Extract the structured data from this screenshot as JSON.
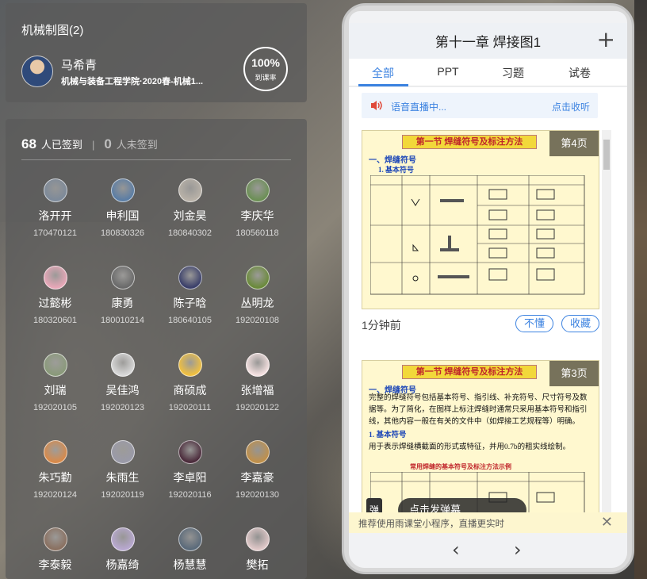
{
  "course": {
    "title": "机械制图(2)",
    "teacher_name": "马希青",
    "school": "机械与装备工程学院·2020春-机械1...",
    "attendance_rate": "100%",
    "attendance_rate_label": "到课率"
  },
  "attendance": {
    "signed_count": "68",
    "signed_label": "人已签到",
    "separator": "|",
    "unsigned_count": "0",
    "unsigned_label": "人未签到",
    "students": [
      {
        "name": "洛开开",
        "id": "170470121",
        "color": "#7d8a9a"
      },
      {
        "name": "申利国",
        "id": "180830326",
        "color": "#5a7da5"
      },
      {
        "name": "刘金昊",
        "id": "180840302",
        "color": "#b9b2a8"
      },
      {
        "name": "李庆华",
        "id": "180560118",
        "color": "#6b8f54"
      },
      {
        "name": "过懿彬",
        "id": "180320601",
        "color": "#e8a7b8"
      },
      {
        "name": "康勇",
        "id": "180010214",
        "color": "#6a6a6a"
      },
      {
        "name": "陈子晗",
        "id": "180640105",
        "color": "#3a3f6a"
      },
      {
        "name": "丛明龙",
        "id": "192020108",
        "color": "#6a8a3a"
      },
      {
        "name": "刘瑞",
        "id": "192020105",
        "color": "#8a9a7a"
      },
      {
        "name": "吴佳鸿",
        "id": "192020123",
        "color": "#d8d8d8"
      },
      {
        "name": "商硕成",
        "id": "192020111",
        "color": "#f0c040"
      },
      {
        "name": "张增福",
        "id": "192020122",
        "color": "#f4e0e0"
      },
      {
        "name": "朱巧勤",
        "id": "192020124",
        "color": "#d88a4a"
      },
      {
        "name": "朱雨生",
        "id": "192020119",
        "color": "#9a9aa8"
      },
      {
        "name": "李卓阳",
        "id": "192020116",
        "color": "#4a2a3a"
      },
      {
        "name": "李嘉豪",
        "id": "192020130",
        "color": "#c0904a"
      },
      {
        "name": "李泰毅",
        "id": "",
        "color": "#8a7060"
      },
      {
        "name": "杨嘉绮",
        "id": "",
        "color": "#b8a8d0"
      },
      {
        "name": "杨慧慧",
        "id": "",
        "color": "#5a6a7a"
      },
      {
        "name": "樊拓",
        "id": "",
        "color": "#e0c8c8"
      }
    ]
  },
  "phone": {
    "title": "第十一章 焊接图1",
    "tabs": [
      "全部",
      "PPT",
      "习题",
      "试卷"
    ],
    "active_tab": "全部",
    "voice_text": "语音直播中...",
    "voice_link": "点击收听",
    "slide1": {
      "badge": "第4页",
      "heading": "第一节 焊缝符号及标注方法",
      "sub": "一、焊缝符号",
      "sub2": "1. 基本符号"
    },
    "meta": {
      "time": "1分钟前",
      "btn_dont_understand": "不懂",
      "btn_collect": "收藏"
    },
    "slide2": {
      "badge": "第3页",
      "heading": "第一节 焊缝符号及标注方法",
      "sub": "一、焊缝符号",
      "body": "完整的焊缝符号包括基本符号、指引线、补充符号、尺寸符号及数据等。为了简化，在图样上标注焊缝时通常只采用基本符号和指引线，其他内容一般在有关的文件中（如焊接工艺规程等）明确。",
      "sub2": "1. 基本符号",
      "body2": "用于表示焊缝横截面的形式或特征，并用0.7b的粗实线绘制。",
      "red": "常用焊缝的基本符号及标注方法示例"
    },
    "danmu_btn": "弹",
    "danmu_send": "点击发弹幕",
    "notice": "推荐使用雨课堂小程序，直播更实时",
    "close": "✕",
    "plus": "+",
    "prev": "‹",
    "next": "›"
  }
}
